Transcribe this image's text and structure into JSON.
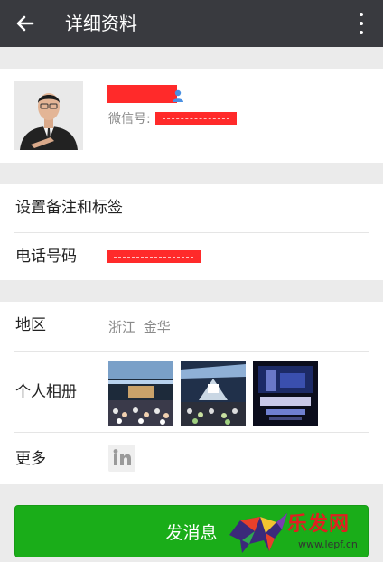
{
  "header": {
    "title": "详细资料"
  },
  "profile": {
    "wechat_id_label": "微信号:"
  },
  "rows": {
    "remark_tags": "设置备注和标签",
    "phone": "电话号码",
    "region": "地区",
    "region_value": "浙江  金华",
    "album": "个人相册",
    "more": "更多"
  },
  "actions": {
    "send_message": "发消息"
  },
  "watermark": {
    "brand": "乐发网",
    "url": "www.lepf.cn"
  },
  "colors": {
    "topbar": "#393a3f",
    "primary_green": "#1aad19",
    "redaction": "#ff2a2a"
  }
}
